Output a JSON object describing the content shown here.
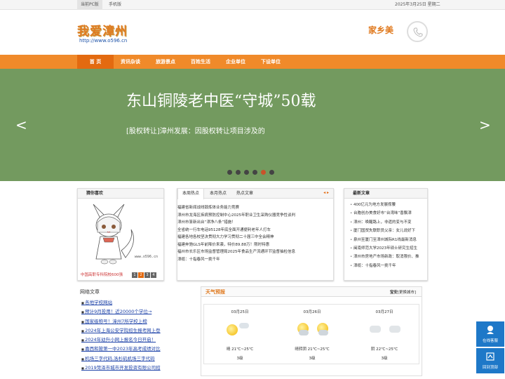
{
  "topbar": {
    "tab_pc": "当前PC版",
    "tab_mobile": "手机版",
    "date": "2025年3月25日 星期二"
  },
  "header": {
    "logo_title": "我爱漳州",
    "logo_url": "http://www.o596.cn",
    "brand": "家乡美"
  },
  "nav": {
    "items": [
      "首 页",
      "资讯杂谈",
      "旅游景点",
      "百姓生活",
      "企业单位",
      "下设单位"
    ]
  },
  "banner": {
    "headline": "东山铜陵老中医“守城”50载",
    "subtitle": "[股权转让]漳州发展：因股权转让项目涉及的",
    "prev": "<",
    "next": ">",
    "active_dot": 5,
    "dot_count": 6
  },
  "recommend": {
    "title": "猜你喜欢",
    "caption": "中国高职专科院校600强",
    "watermark": "www.o596.cn",
    "pages": [
      "1",
      "2",
      "3",
      "4"
    ],
    "active_page": "2"
  },
  "news": {
    "tabs": [
      "本周热点",
      "本月热点",
      "热点文章"
    ],
    "next": "◂ ▸",
    "items": [
      "福建省新闻战线锻炼体业务能力竞赛",
      "漳州市龙海区疾病预防控制中心2025年职业卫生采购仪器竞争性谈判",
      "漳州市篆新出台“漳净八条”措施！",
      "全省统一行车电话95128年底全面开通便利老年人打车",
      "福建各地各校坚决贯彻大力学习贯彻二十届三中全会精神",
      "福建奔驰GLS年前降价来袭，特价89.88万！限时特惠",
      "福州市长乐区市场监督管理局2025年食品生产流通环节监督抽检信息",
      "漳缆：十指春风一挑千年"
    ]
  },
  "latest": {
    "title": "最新文章",
    "items": [
      "400亿元为地方发展撑腰",
      "台胞创办美食好市“台湾味”香飘漳",
      "漳州：唤醒路上，非遗的变与不变",
      "厦门国贸失联职员父亲：女儿说好下",
      "泉州至厦门至漳州城际R1线最新消息",
      "闽南师范大学2023年硕士研究生招生",
      "漳州市房地产市场新政：取消限价、推",
      "漳缆：十指春风一挑千年"
    ]
  },
  "web_articles": {
    "title": "网络文章",
    "items": [
      "各地学校网站",
      "预计9月投用！近20000个学位→",
      "国家级称号！漳州7所学校上榜",
      "2024年上海公安学院招生报考网上登",
      "2024年幼升小网上报名今日开启！",
      "嘉西和陂第一中2023年高考成绩对比",
      "机场三字代码,洛杉矶机场三字代码",
      "2019菏泽市城市开发投资有限公司招"
    ]
  },
  "weather": {
    "title": "天气预报",
    "city": "宝安",
    "change_city": "[更换城市]",
    "days": [
      {
        "date": "03月25日",
        "desc": "晴 21℃~25℃",
        "level": "3级"
      },
      {
        "date": "03月26日",
        "desc": "晴转阴 21℃~25℃",
        "level": "3级"
      },
      {
        "date": "03月27日",
        "desc": "阴 22℃~25℃",
        "level": "3级"
      }
    ]
  },
  "float": {
    "service": "在线客服",
    "top": "回到顶部"
  },
  "colors": {
    "accent": "#f08a2a",
    "nav_active": "#e36a10",
    "banner": "#739a5f",
    "link": "#1d42a8",
    "float": "#1e78c8"
  }
}
